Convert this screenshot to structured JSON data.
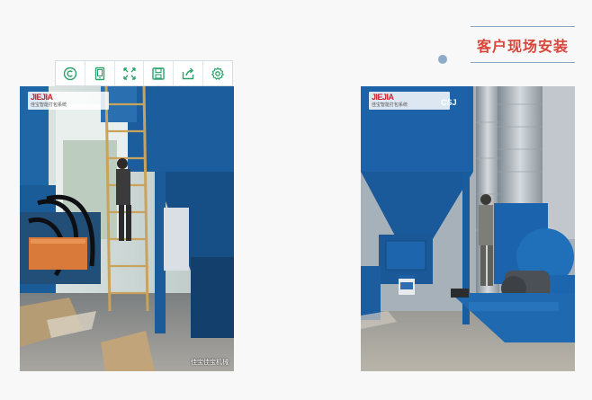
{
  "section": {
    "title": "客户现场安装"
  },
  "toolbar": {
    "tools": [
      {
        "icon": "copyright-icon"
      },
      {
        "icon": "tablet-icon"
      },
      {
        "icon": "fullscreen-icon"
      },
      {
        "icon": "save-icon"
      },
      {
        "icon": "share-icon"
      },
      {
        "icon": "gear-icon"
      }
    ],
    "color": "#2aa36b"
  },
  "photos": {
    "left": {
      "brand": "JIEJIA",
      "tagline": "佳宝智能打包系统",
      "credit": "佳宝佳宝机械"
    },
    "right": {
      "brand": "JIEJIA",
      "tagline": "佳宝智能打包系统",
      "logo2": "CSJ"
    }
  }
}
